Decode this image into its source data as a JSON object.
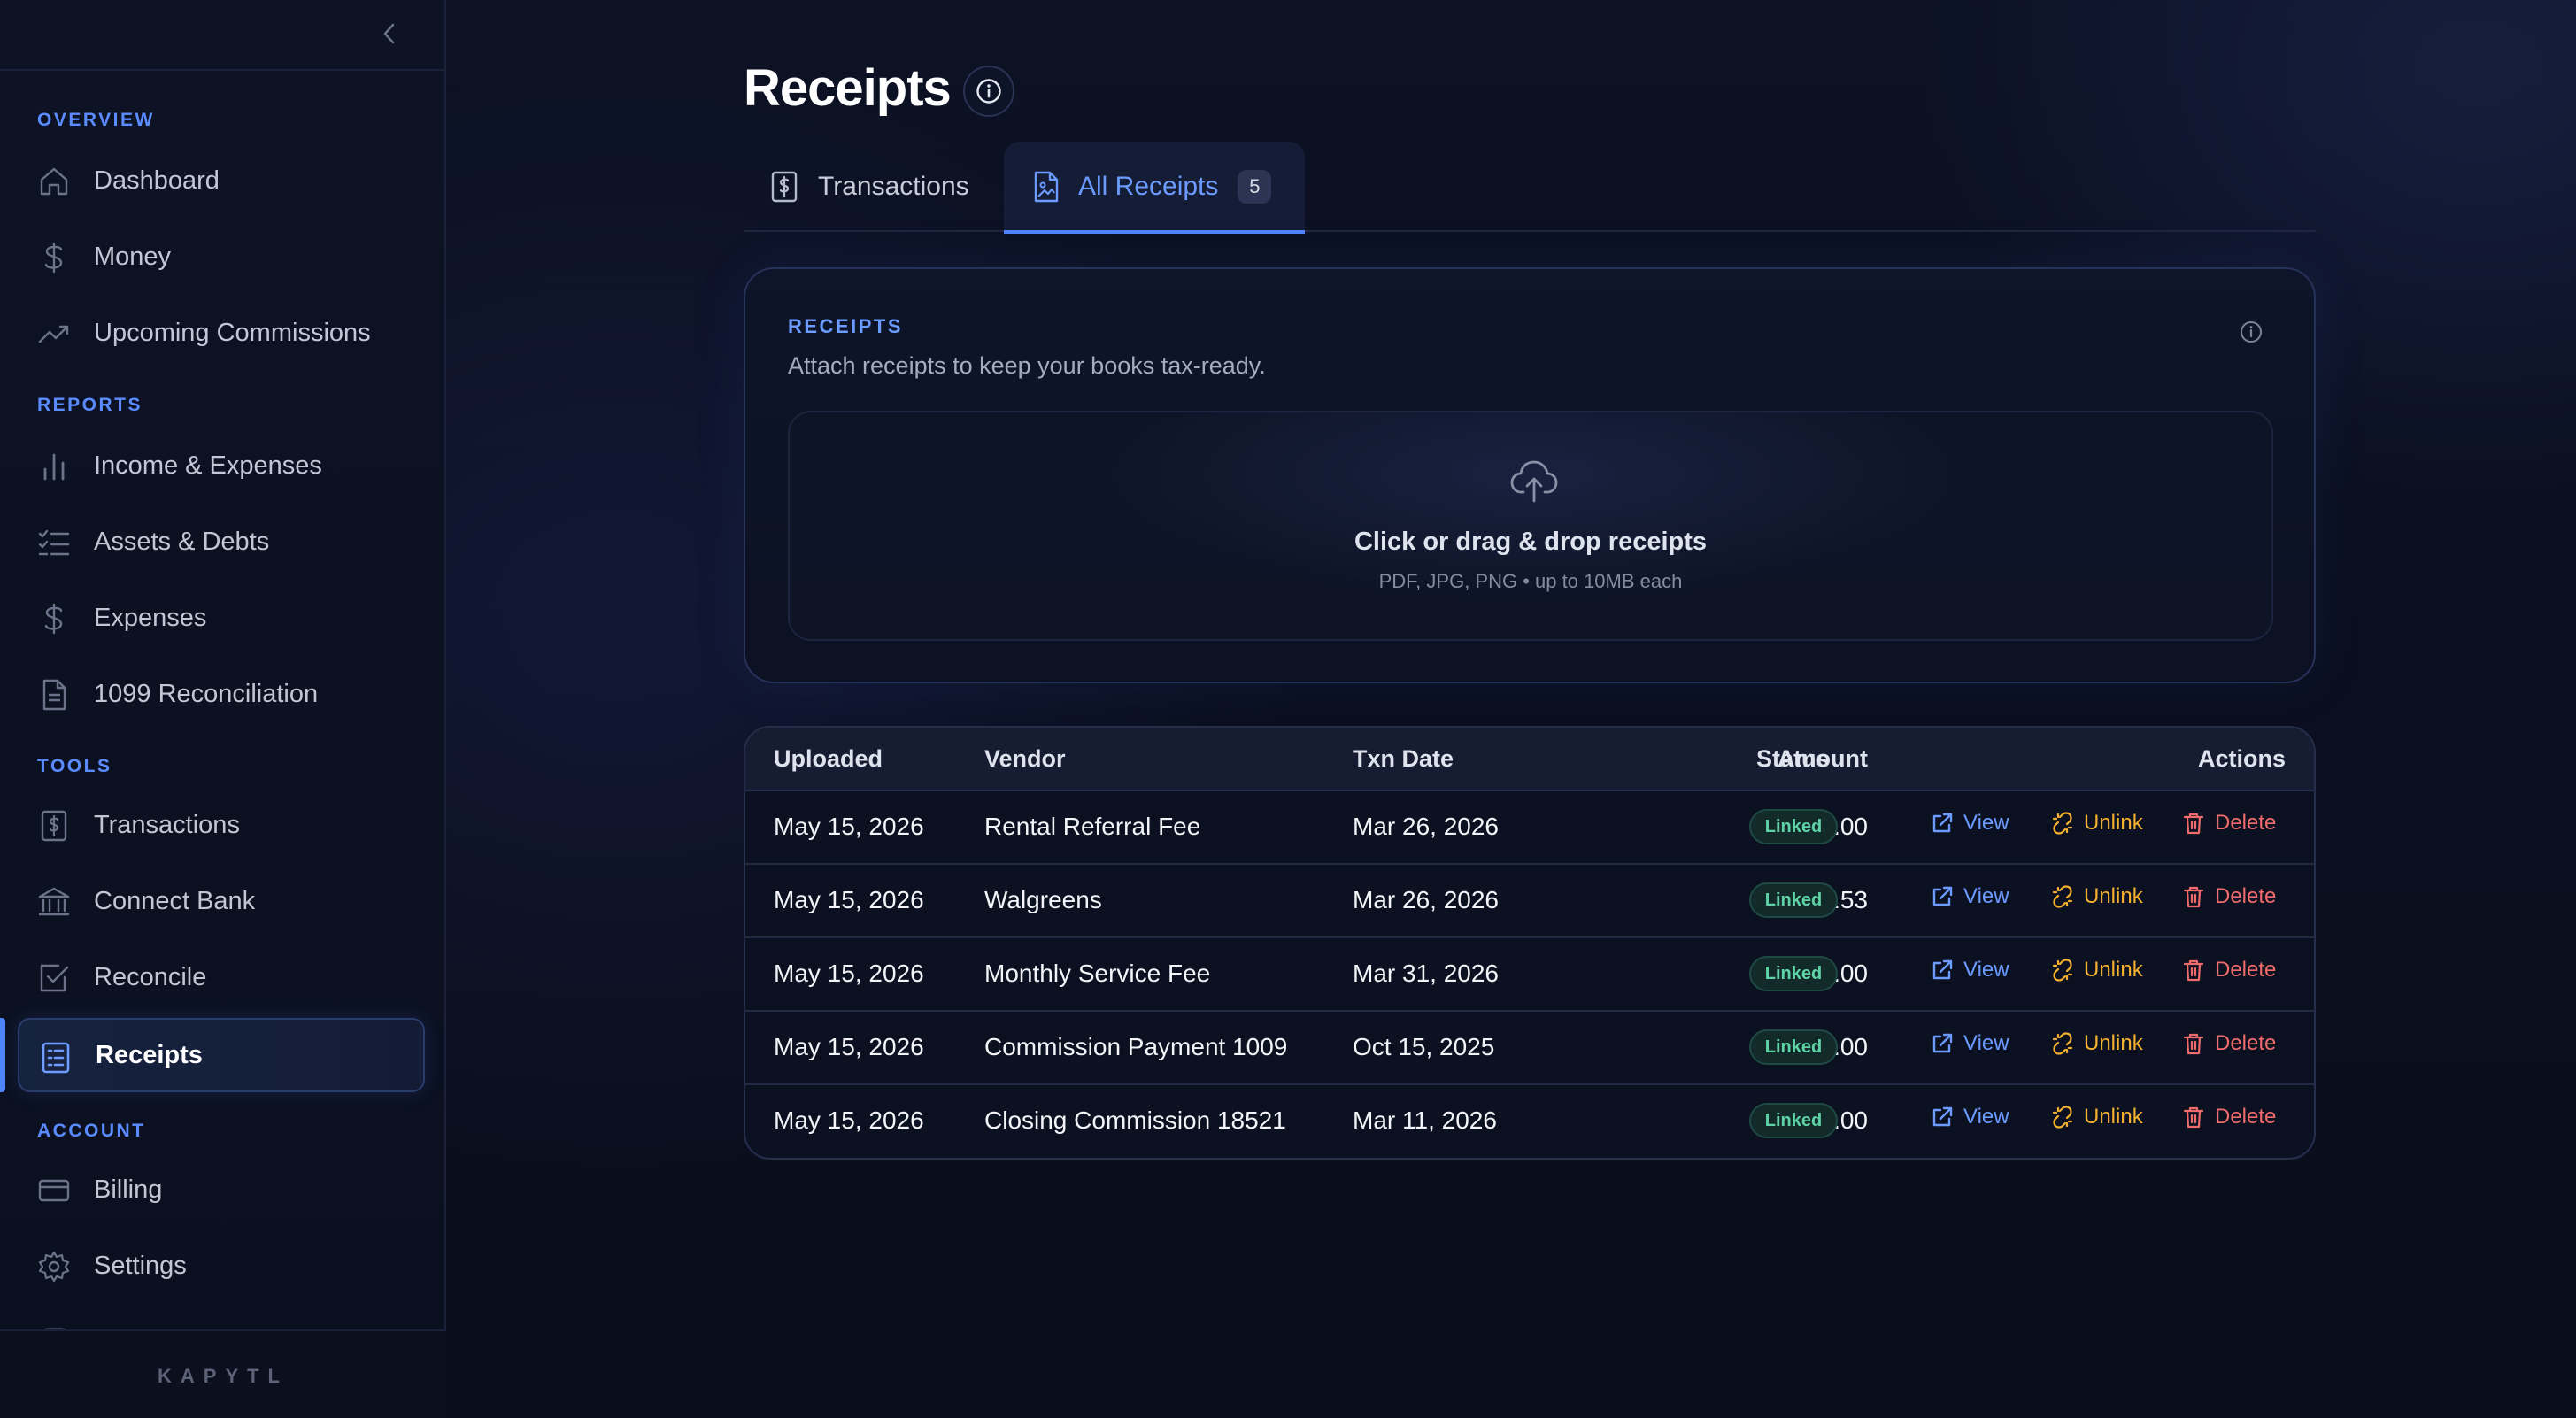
{
  "sidebar": {
    "sections": {
      "overview": "OVERVIEW",
      "reports": "REPORTS",
      "tools": "TOOLS",
      "account": "ACCOUNT"
    },
    "items": [
      {
        "label": "Dashboard",
        "icon": "home-icon"
      },
      {
        "label": "Money",
        "icon": "dollar-icon"
      },
      {
        "label": "Upcoming Commissions",
        "icon": "trending-up-icon"
      },
      {
        "label": "Income & Expenses",
        "icon": "bar-chart-icon"
      },
      {
        "label": "Assets & Debts",
        "icon": "checklist-icon"
      },
      {
        "label": "Expenses",
        "icon": "dollar-icon"
      },
      {
        "label": "1099 Reconciliation",
        "icon": "document-icon"
      },
      {
        "label": "Transactions",
        "icon": "receipt-dollar-icon"
      },
      {
        "label": "Connect Bank",
        "icon": "bank-icon"
      },
      {
        "label": "Reconcile",
        "icon": "checkbox-icon"
      },
      {
        "label": "Receipts",
        "icon": "receipt-icon",
        "active": true
      },
      {
        "label": "Billing",
        "icon": "credit-card-icon"
      },
      {
        "label": "Settings",
        "icon": "gear-icon"
      }
    ],
    "brand": "KAPYTL"
  },
  "page": {
    "title": "Receipts"
  },
  "tabs": [
    {
      "label": "Transactions",
      "icon": "receipt-dollar-icon"
    },
    {
      "label": "All Receipts",
      "icon": "file-image-icon",
      "count": "5",
      "active": true
    }
  ],
  "upload_card": {
    "eyebrow": "RECEIPTS",
    "description": "Attach receipts to keep your books tax-ready.",
    "dropzone_title": "Click or drag & drop receipts",
    "dropzone_subtitle": "PDF, JPG, PNG • up to 10MB each"
  },
  "table": {
    "columns": [
      "Uploaded",
      "Vendor",
      "Txn Date",
      "Amount",
      "Status",
      "Actions"
    ],
    "rows": [
      {
        "uploaded": "May 15, 2026",
        "vendor": "Rental Referral Fee",
        "txn_date": "Mar 26, 2026",
        "amount": "$350.00",
        "status": "Linked"
      },
      {
        "uploaded": "May 15, 2026",
        "vendor": "Walgreens",
        "txn_date": "Mar 26, 2026",
        "amount": "-$24.53",
        "status": "Linked"
      },
      {
        "uploaded": "May 15, 2026",
        "vendor": "Monthly Service Fee",
        "txn_date": "Mar 31, 2026",
        "amount": "-$12.00",
        "status": "Linked"
      },
      {
        "uploaded": "May 15, 2026",
        "vendor": "Commission Payment 1009",
        "txn_date": "Oct 15, 2025",
        "amount": "$4,650.00",
        "status": "Linked"
      },
      {
        "uploaded": "May 15, 2026",
        "vendor": "Closing Commission 18521",
        "txn_date": "Mar 11, 2026",
        "amount": "$5,100.00",
        "status": "Linked"
      }
    ],
    "actions": {
      "view": "View",
      "unlink": "Unlink",
      "delete": "Delete"
    }
  },
  "colors": {
    "accent": "#4f86ff",
    "link": "#6b9bff",
    "unlink": "#f5b12f",
    "delete": "#f06b6b",
    "status_linked": "#5fd3a5"
  }
}
